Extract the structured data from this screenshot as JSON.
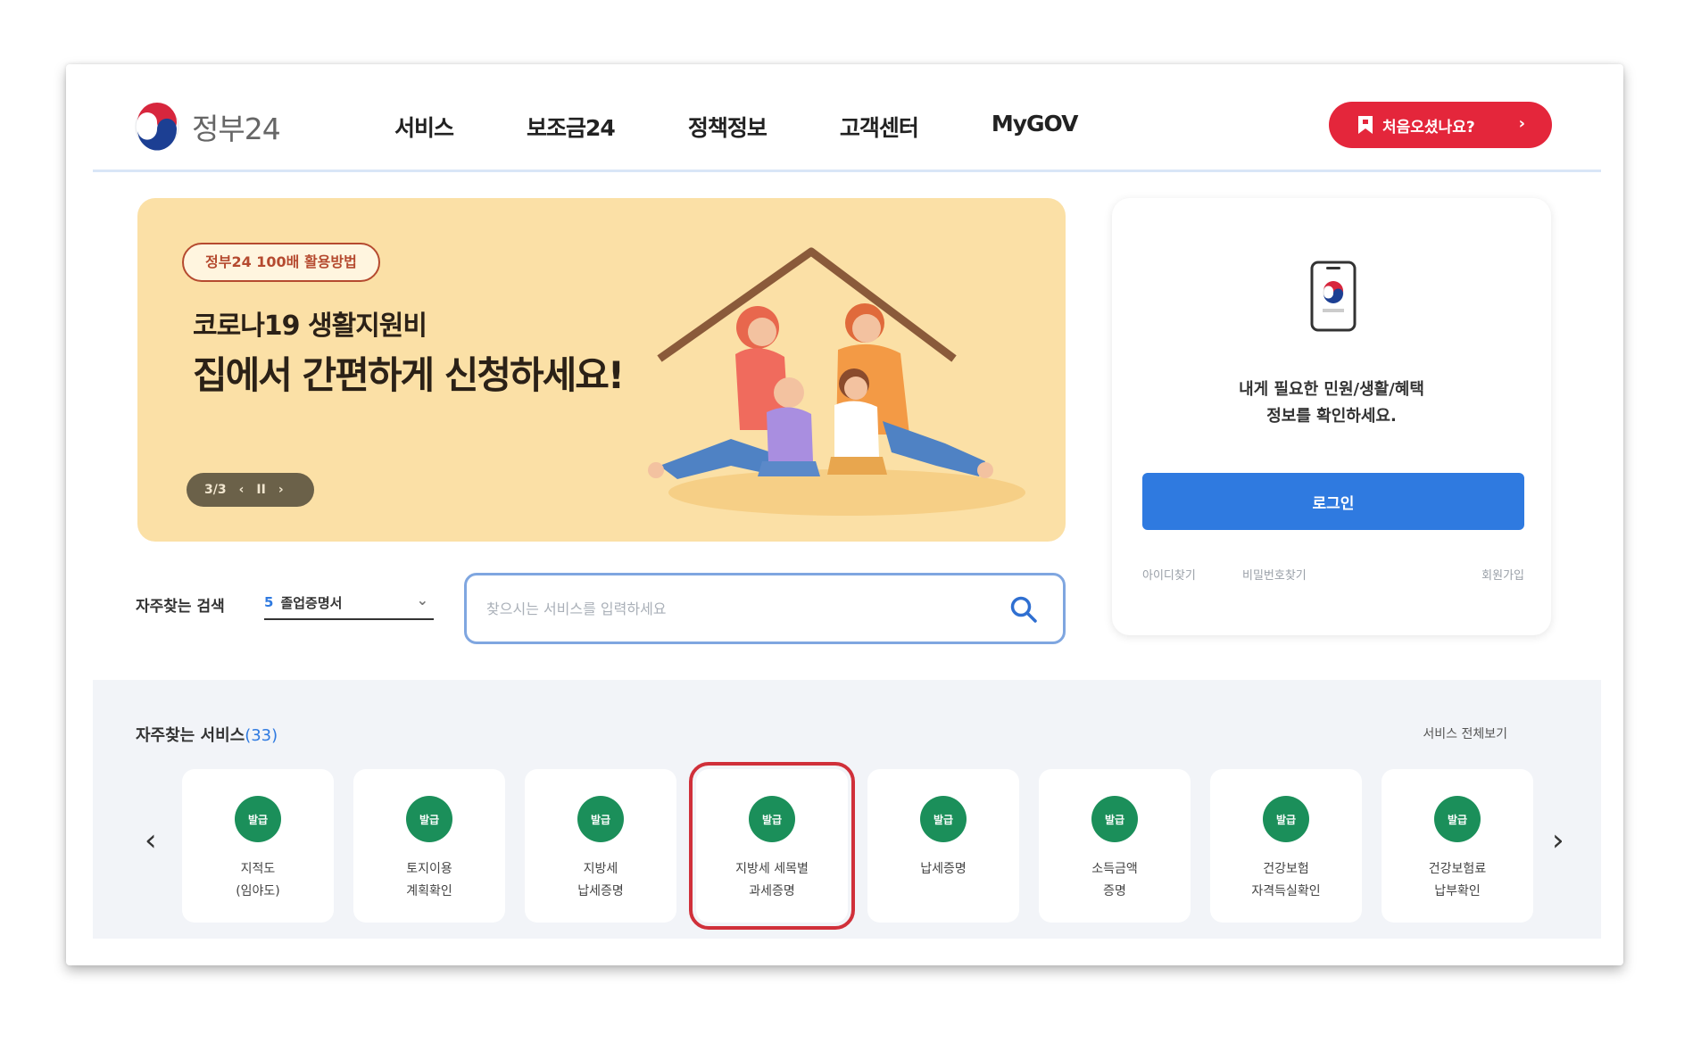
{
  "header": {
    "logo_text": "정부24",
    "nav": [
      "서비스",
      "보조금24",
      "정책정보",
      "고객센터",
      "MyGOV"
    ],
    "first_visit_label": "처음오셨나요?",
    "first_visit_arrow": "›"
  },
  "banner": {
    "tag": "정부24 100배 활용방법",
    "line1": "코로나19 생활지원비",
    "line2": "집에서 간편하게 신청하세요!",
    "pager": {
      "page": "3/3",
      "prev": "‹",
      "pause": "II",
      "next": "›"
    }
  },
  "login": {
    "message_line1": "내게 필요한 민원/생활/혜택",
    "message_line2": "정보를 확인하세요.",
    "login_button": "로그인",
    "find_id": "아이디찾기",
    "find_password": "비밀번호찾기",
    "signup": "회원가입"
  },
  "search": {
    "favorites_label": "자주찾는 검색",
    "favorites_rank": "5",
    "favorites_value": "졸업증명서",
    "placeholder": "찾으시는 서비스를 입력하세요"
  },
  "services": {
    "title": "자주찾는 서비스",
    "count": "(33)",
    "view_all": "서비스 전체보기",
    "badge": "발급",
    "items": [
      {
        "name": "지적도\n(임야도)"
      },
      {
        "name": "토지이용\n계획확인"
      },
      {
        "name": "지방세\n납세증명"
      },
      {
        "name": "지방세 세목별\n과세증명"
      },
      {
        "name": "납세증명"
      },
      {
        "name": "소득금액\n증명"
      },
      {
        "name": "건강보험\n자격득실확인"
      },
      {
        "name": "건강보험료\n납부확인"
      }
    ],
    "highlighted_index": 3,
    "prev_arrow": "‹",
    "next_arrow": "›"
  },
  "colors": {
    "primary": "#2f7ae0",
    "accent_red": "#e4263b",
    "badge_green": "#1b8f5a",
    "banner_bg": "#fbe0a6",
    "highlight_border": "#d0303a"
  }
}
